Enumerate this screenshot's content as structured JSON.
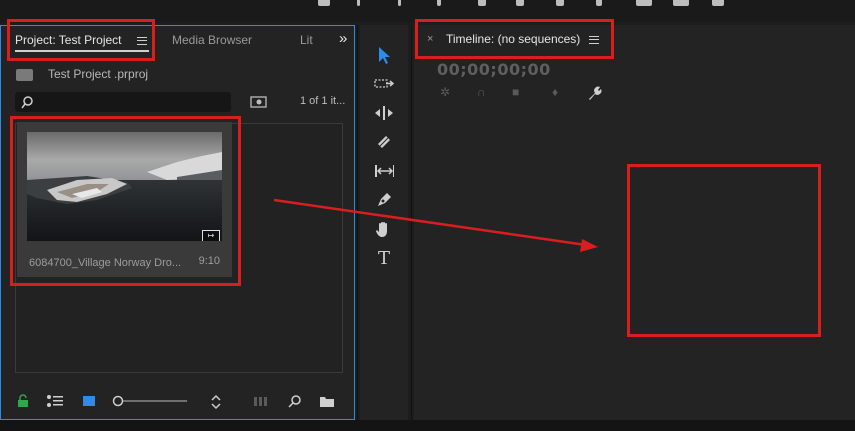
{
  "project_panel": {
    "tab_project": "Project: Test Project",
    "tab_media_browser": "Media Browser",
    "tab_libraries": "Lit",
    "overflow": "»",
    "project_file": "Test Project .prproj",
    "search_placeholder": "",
    "item_count": "1 of 1 it...",
    "clip": {
      "name": "6084700_Village Norway Dro...",
      "duration": "9:10",
      "badge": "↦"
    }
  },
  "timeline_panel": {
    "close": "×",
    "tab_title": "Timeline: (no sequences)",
    "timecode": "00;00;00;00"
  },
  "tools": [
    "selection-tool",
    "track-select-tool",
    "ripple-edit-tool",
    "razor-tool",
    "slip-tool",
    "pen-tool",
    "hand-tool",
    "type-tool"
  ],
  "colors": {
    "accent": "#2d8ceb",
    "annotation": "#d81e1e",
    "panel_bg": "#232323"
  }
}
